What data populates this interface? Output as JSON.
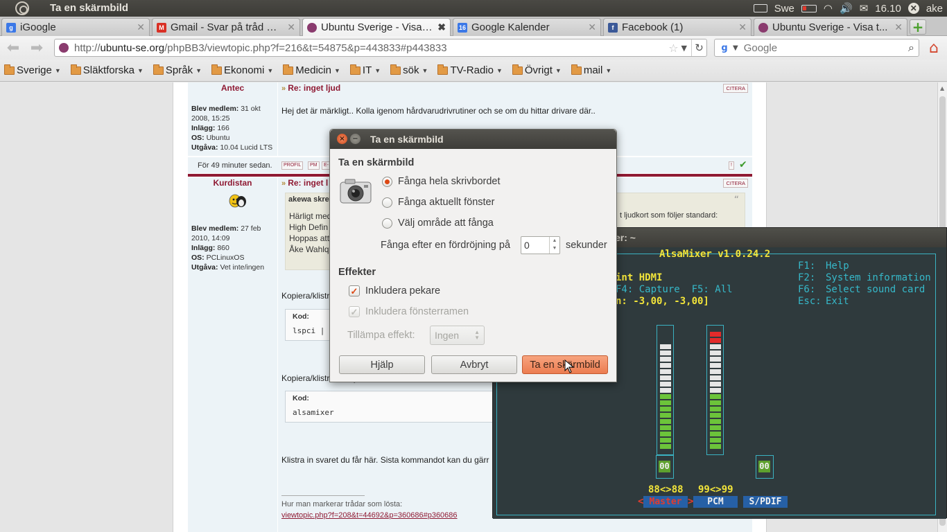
{
  "top_panel": {
    "window_title": "Ta en skärmbild",
    "keyboard_layout": "Swe",
    "clock": "16.10",
    "user": "ake"
  },
  "browser": {
    "tabs": [
      {
        "label": "iGoogle",
        "icon": "google-icon",
        "color": "#3b78e7",
        "active": false
      },
      {
        "label": "Gmail - Svar på tråd — ...",
        "icon": "gmail-icon",
        "color": "#d93025",
        "active": false
      },
      {
        "label": "Ubuntu Sverige - Visa t...",
        "icon": "ubuntu-icon",
        "color": "#8a3b6e",
        "active": true
      },
      {
        "label": "Google Kalender",
        "icon": "calendar-icon",
        "color": "#3b78e7",
        "active": false
      },
      {
        "label": "Facebook (1)",
        "icon": "facebook-icon",
        "color": "#3b5998",
        "active": false
      },
      {
        "label": "Ubuntu Sverige - Visa t...",
        "icon": "ubuntu-icon",
        "color": "#8a3b6e",
        "active": false
      }
    ],
    "url_prefix": "http://",
    "url_host": "ubuntu-se.org",
    "url_path": "/phpBB3/viewtopic.php?f=216&t=54875&p=443833#p443833",
    "search_placeholder": "Google",
    "bookmarks": [
      "Sverige",
      "Släktforska",
      "Språk",
      "Ekonomi",
      "Medicin",
      "IT",
      "sök",
      "TV-Radio",
      "Övrigt",
      "mail"
    ]
  },
  "forum": {
    "post1": {
      "author": "Antec",
      "subject": "Re: inget ljud",
      "member_since_label": "Blev medlem:",
      "member_since_l1": "31 okt",
      "member_since_l2": "2008, 15:25",
      "posts_label": "Inlägg:",
      "posts": "166",
      "os_label": "OS:",
      "os": "Ubuntu",
      "edition_label": "Utgåva:",
      "edition": "10.04 Lucid LTS",
      "text": "Hej det är märkligt.. Kolla igenom hårdvarudrivrutiner och se om du hittar drivare där..",
      "citera": "CITERA",
      "footer_time": "För 49 minuter sedan.",
      "footer_btns": [
        "PROFIL",
        "PM",
        "E-"
      ]
    },
    "post2": {
      "author": "Kurdistan",
      "subject": "Re: inget l",
      "member_since_label": "Blev medlem:",
      "member_since_l1": "27 feb",
      "member_since_l2": "2010, 14:09",
      "posts_label": "Inlägg:",
      "posts": "860",
      "os_label": "OS:",
      "os": "PCLinuxOS",
      "edition_label": "Utgåva:",
      "edition": "Vet inte/ingen",
      "citera": "CITERA",
      "quote_head": "akewa skrev",
      "quote_lines": [
        "Härligt med",
        "High Defin",
        "Hoppas att",
        "Åke Wahlq"
      ],
      "quote_overflow": "t ljudkort som följer standard:",
      "copy1": "Kopiera/klistr",
      "code_label": "Kod:",
      "code1": "lspci | g",
      "copy2": "Kopiera/klistra in följande kommando:",
      "code2": "alsamixer",
      "paste": "Klistra in svaret du får här. Sista kommandot kan du gärr",
      "sig_title": "Hur man markerar trådar som lösta:",
      "sig_link": "viewtopic.php?f=208&t=44692&p=360686#p360686"
    }
  },
  "terminal": {
    "title_fragment": "er: ~",
    "app_title": "AlsaMixer v1.0.24.2",
    "card": "int HDMI",
    "view_keys": "F4: Capture  F5: All",
    "db_line": "n: -3,00, -3,00]",
    "help": [
      {
        "key": "F1:",
        "action": "Help"
      },
      {
        "key": "F2:",
        "action": "System information"
      },
      {
        "key": "F6:",
        "action": "Select sound card"
      },
      {
        "key": "Esc:",
        "action": "Exit"
      }
    ],
    "channels": [
      {
        "name": "Master",
        "volume_label": "88<>88",
        "mute": "00",
        "level_percent": 88,
        "selected": true
      },
      {
        "name": "PCM",
        "volume_label": "99<>99",
        "mute": "",
        "level_percent": 99,
        "selected": false
      },
      {
        "name": "S/PDIF",
        "volume_label": "",
        "mute": "00",
        "level_percent": 0,
        "selected": false
      }
    ]
  },
  "dialog": {
    "title": "Ta en skärmbild",
    "heading": "Ta en skärmbild",
    "options": [
      {
        "label": "Fånga hela skrivbordet",
        "selected": true
      },
      {
        "label": "Fånga aktuellt fönster",
        "selected": false
      },
      {
        "label": "Välj område att fånga",
        "selected": false
      }
    ],
    "delay_label": "Fånga efter en fördröjning på",
    "delay_value": "0",
    "delay_unit": "sekunder",
    "effects_heading": "Effekter",
    "include_pointer": "Inkludera pekare",
    "include_border": "Inkludera fönsterramen",
    "apply_effect_label": "Tillämpa effekt:",
    "apply_effect_value": "Ingen",
    "help_button": "Hjälp",
    "cancel_button": "Avbryt",
    "take_button": "Ta en skärmbild"
  }
}
